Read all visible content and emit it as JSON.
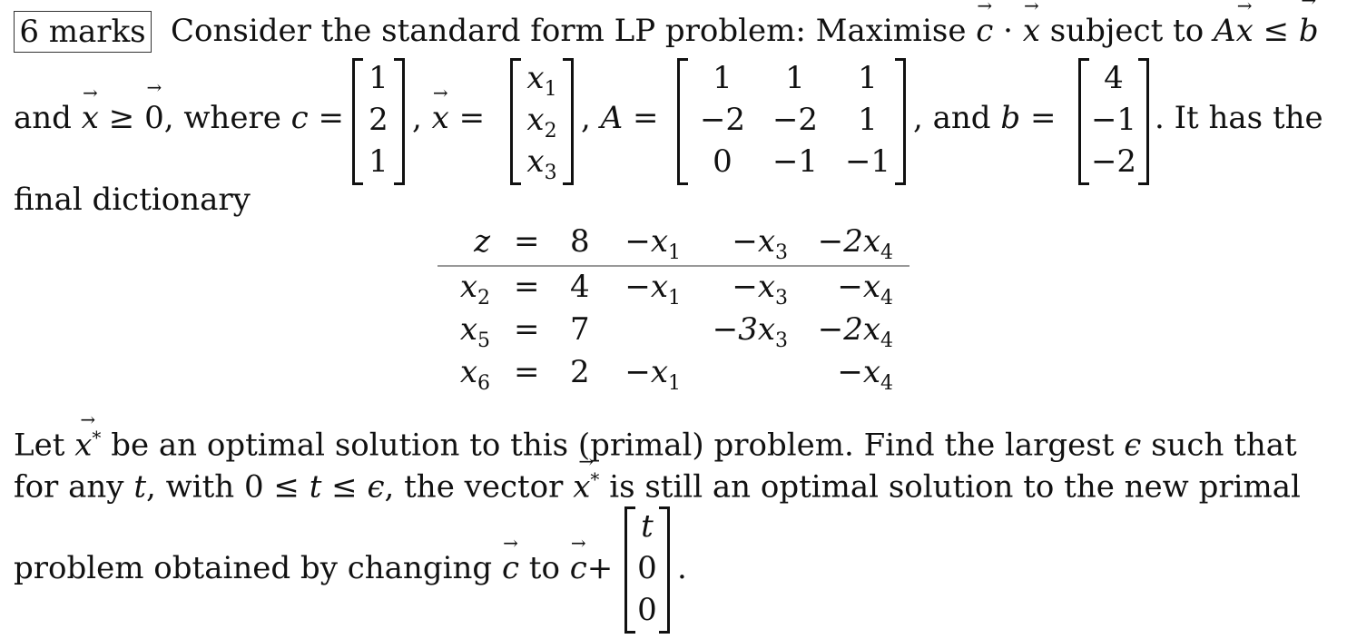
{
  "header": {
    "marks_label": "6 marks",
    "intro": "Consider the standard form LP problem: Maximise",
    "c_vec": "c",
    "dot": "·",
    "x_vec": "x",
    "subject_to": "subject to",
    "A": "A",
    "leq": "≤",
    "b_vec": "b"
  },
  "line2": {
    "and": "and",
    "x_vec": "x",
    "geq": "≥",
    "zero_vec": "0",
    "where": ", where",
    "c_label": "c =",
    "comma1": ",",
    "x_label": "=",
    "comma2": ",",
    "A_label": "A =",
    "and_b": ", and",
    "b_label": "b =",
    "tail": ". It has the"
  },
  "matrices": {
    "c": [
      "1",
      "2",
      "1"
    ],
    "x": [
      {
        "base": "x",
        "sub": "1"
      },
      {
        "base": "x",
        "sub": "2"
      },
      {
        "base": "x",
        "sub": "3"
      }
    ],
    "A": [
      [
        "1",
        "1",
        "1"
      ],
      [
        "−2",
        "−2",
        "1"
      ],
      [
        "0",
        "−1",
        "−1"
      ]
    ],
    "b": [
      "4",
      "−1",
      "−2"
    ],
    "t_vec": [
      "t",
      "0",
      "0"
    ]
  },
  "final_dictionary_label": "final dictionary",
  "dictionary": {
    "objective": {
      "lhs": "z",
      "sub": "",
      "eq": "=",
      "const": "8",
      "terms": [
        "−x|1",
        "−x|3",
        "−2x|4"
      ]
    },
    "rows": [
      {
        "lhs": "x",
        "sub": "2",
        "eq": "=",
        "const": "4",
        "terms": [
          "−x|1",
          "−x|3",
          "−x|4"
        ]
      },
      {
        "lhs": "x",
        "sub": "5",
        "eq": "=",
        "const": "7",
        "terms": [
          "",
          "−3x|3",
          "−2x|4"
        ]
      },
      {
        "lhs": "x",
        "sub": "6",
        "eq": "=",
        "const": "2",
        "terms": [
          "−x|1",
          "",
          "−x|4"
        ]
      }
    ]
  },
  "question": {
    "line1_a": "Let",
    "xstar": "x",
    "star": "*",
    "line1_b": "be an optimal solution to this (primal) problem.  Find the largest",
    "epsilon": "ϵ",
    "line1_c": "such that",
    "line2_a": "for any",
    "t": "t",
    "line2_b": ", with 0 ≤",
    "line2_c": "≤",
    "line2_d": ", the vector",
    "line2_e": "is still an optimal solution to the new primal",
    "line3_a": "problem obtained by changing",
    "c_vec": "c",
    "line3_b": "to",
    "plus": "+",
    "period": "."
  }
}
